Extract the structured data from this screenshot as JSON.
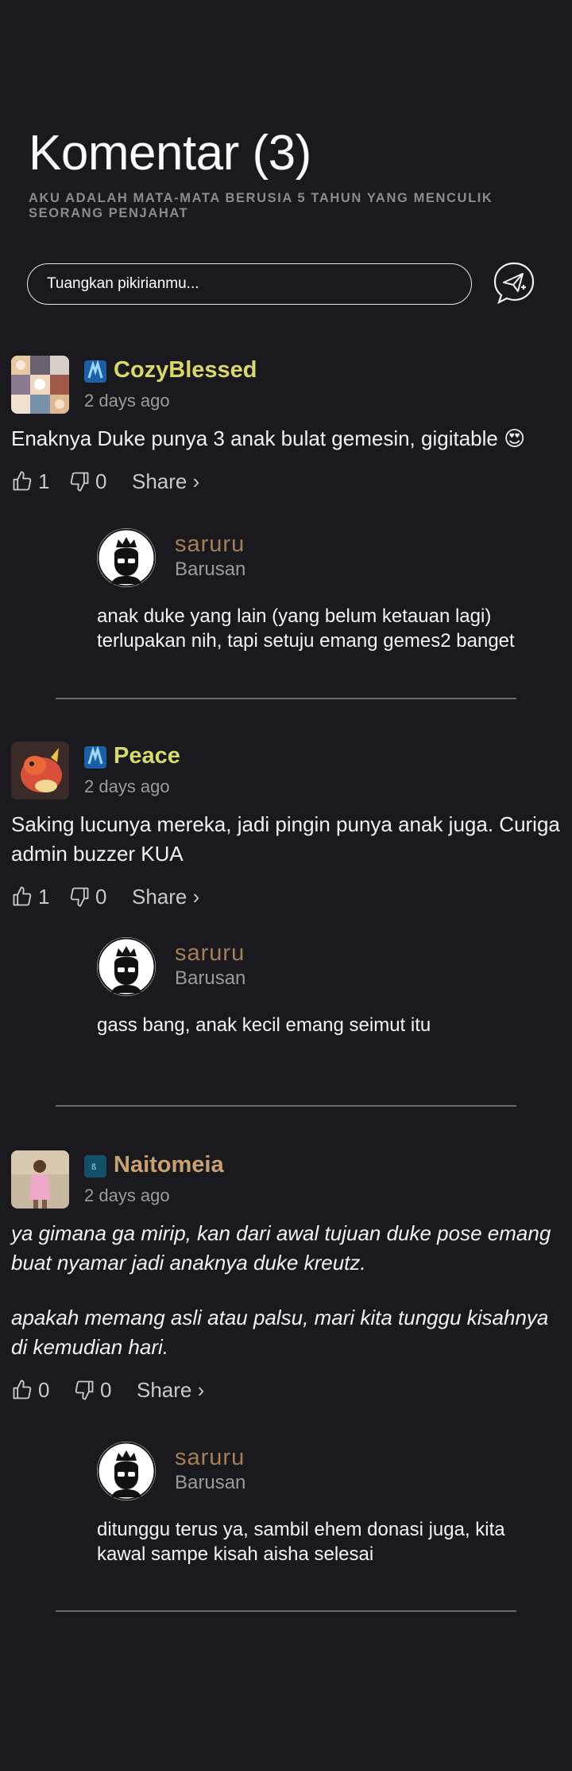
{
  "header": {
    "title": "Komentar (3)",
    "subtitle": "AKU ADALAH MATA-MATA BERUSIA 5 TAHUN YANG MENCULIK SEORANG PENJAHAT"
  },
  "composer": {
    "placeholder": "Tuangkan pikirianmu..."
  },
  "colors": {
    "background": "#1a1a1e",
    "username_gold": "#d9d96a",
    "username_tan": "#c9a26f",
    "admin_name": "#a47e57"
  },
  "comments": [
    {
      "user": "CozyBlessed",
      "time": "2 days ago",
      "text": "Enaknya Duke punya 3 anak bulat gemesin, gigitable 😍",
      "likes": "1",
      "dislikes": "0",
      "share": "Share ›",
      "reply": {
        "user": "saruru",
        "time": "Barusan",
        "text": "anak duke yang lain (yang belum ketauan lagi) terlupakan nih, tapi setuju emang gemes2 banget"
      }
    },
    {
      "user": "Peace",
      "time": "2 days ago",
      "text": "Saking lucunya mereka, jadi pingin punya anak juga. Curiga admin buzzer KUA",
      "likes": "1",
      "dislikes": "0",
      "share": "Share ›",
      "reply": {
        "user": "saruru",
        "time": "Barusan",
        "text": "gass bang, anak kecil emang seimut itu"
      }
    },
    {
      "user": "Naitomeia",
      "time": "2 days ago",
      "text_p1": "ya gimana ga mirip, kan dari awal tujuan duke pose emang buat nyamar jadi anaknya duke kreutz.",
      "text_p2": "apakah memang asli atau palsu, mari kita tunggu kisahnya di kemudian hari.",
      "likes": "0",
      "dislikes": "0",
      "share": "Share ›",
      "reply": {
        "user": "saruru",
        "time": "Barusan",
        "text": "ditunggu terus ya, sambil ehem donasi juga, kita kawal sampe kisah aisha selesai"
      }
    }
  ]
}
